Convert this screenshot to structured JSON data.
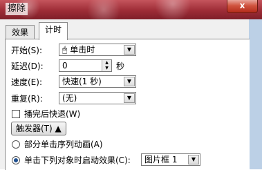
{
  "window": {
    "title": "擦除",
    "close_label": "x"
  },
  "tabs": [
    {
      "label": "效果"
    },
    {
      "label": "计时"
    }
  ],
  "timing": {
    "start": {
      "label": "开始(S):",
      "value": "单击时",
      "icon": "mouse-icon"
    },
    "delay": {
      "label": "延迟(D):",
      "value": "0",
      "unit": "秒"
    },
    "speed": {
      "label": "速度(E):",
      "value": "快速(1 秒)"
    },
    "repeat": {
      "label": "重复(R):",
      "value": "(无)"
    },
    "rewind": {
      "label": "播完后快退(W)",
      "checked": false
    },
    "triggers_button": "触发器(T) ▲",
    "radio_sequence": {
      "label": "部分单击序列动画(A)",
      "checked": false
    },
    "radio_object": {
      "label": "单击下列对象时启动效果(C):",
      "checked": true
    },
    "object_select": {
      "value": "图片框 1"
    }
  }
}
